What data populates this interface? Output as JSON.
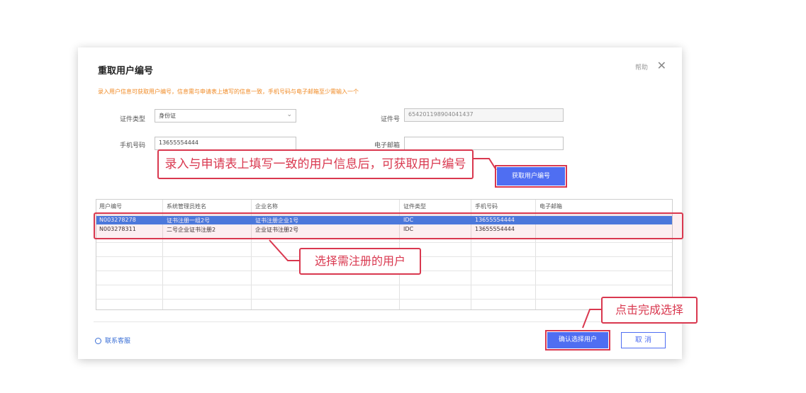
{
  "dialog": {
    "title": "重取用户编号",
    "help": "帮助",
    "close": "✕",
    "notice": "录入用户信息可获取用户编号，信息需与申请表上填写的信息一致，手机号码与电子邮箱至少需输入一个"
  },
  "form": {
    "id_type_label": "证件类型",
    "id_type_value": "身份证",
    "id_number_label": "证件号",
    "id_number_value": "654201198904041437",
    "phone_label": "手机号码",
    "phone_value": "13655554444",
    "email_label": "电子邮箱",
    "email_value": "",
    "fetch_button": "获取用户编号"
  },
  "table": {
    "headers": [
      "用户编号",
      "系统管理员姓名",
      "企业名称",
      "证件类型",
      "手机号码",
      "电子邮箱"
    ],
    "rows": [
      {
        "id": "N003278278",
        "admin": "证书注册一组2号",
        "company": "证书注册企业1号",
        "cert": "IDC",
        "phone": "13655554444",
        "email": "",
        "selected": true
      },
      {
        "id": "N003278311",
        "admin": "二号企业证书注册2",
        "company": "企业证书注册2号",
        "cert": "IDC",
        "phone": "13655554444",
        "email": "",
        "selected": false
      }
    ]
  },
  "footer": {
    "support": "联系客服",
    "confirm": "确认选择用户",
    "cancel": "取 消"
  },
  "callouts": {
    "fetch": "录入与申请表上填写一致的用户信息后，可获取用户编号",
    "select": "选择需注册的用户",
    "confirm": "点击完成选择"
  },
  "colors": {
    "primary": "#4f6ef2",
    "highlight": "#d9384f",
    "notice": "#f08a24",
    "selected_row": "#3f7ee8"
  }
}
